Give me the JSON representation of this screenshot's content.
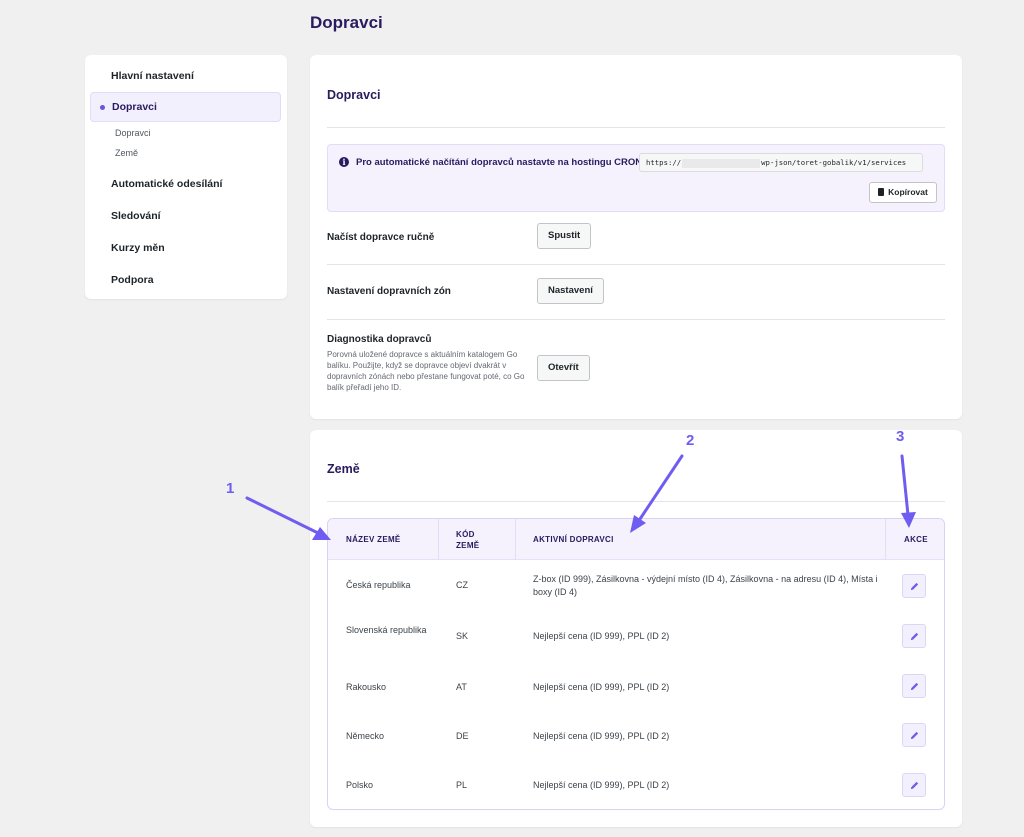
{
  "page": {
    "title": "Dopravci"
  },
  "sidebar": {
    "items": [
      {
        "label": "Hlavní nastavení"
      },
      {
        "label": "Dopravci",
        "subitems": [
          {
            "label": "Dopravci"
          },
          {
            "label": "Země"
          }
        ]
      },
      {
        "label": "Automatické odesílání"
      },
      {
        "label": "Sledování"
      },
      {
        "label": "Kurzy měn"
      },
      {
        "label": "Podpora"
      }
    ]
  },
  "carriers_card": {
    "title": "Dopravci",
    "notice": {
      "text": "Pro automatické načítání dopravců nastavte na hostingu CRON",
      "url_prefix": "https://",
      "url_suffix": "wp-json/toret-gobalik/v1/services",
      "copy_label": "Kopírovat"
    },
    "rows": [
      {
        "label": "Načíst dopravce ručně",
        "button": "Spustit"
      },
      {
        "label": "Nastavení dopravních zón",
        "button": "Nastavení"
      },
      {
        "label": "Diagnostika dopravců",
        "description": "Porovná uložené dopravce s aktuálním katalogem Go balíku. Použijte, když se dopravce objeví dvakrát v dopravních zónách nebo přestane fungovat poté, co Go balík přeřadí jeho ID.",
        "button": "Otevřít"
      }
    ]
  },
  "countries_card": {
    "title": "Země",
    "columns": [
      "NÁZEV ZEMĚ",
      "KÓD ZEMĚ",
      "AKTIVNÍ DOPRAVCI",
      "AKCE"
    ],
    "rows": [
      {
        "name": "Česká republika",
        "code": "CZ",
        "carriers": "Z-box (ID 999), Zásilkovna - výdejní místo (ID 4), Zásilkovna - na adresu (ID 4), Místa i boxy (ID 4)"
      },
      {
        "name": "Slovenská republika",
        "code": "SK",
        "carriers": "Nejlepší cena (ID 999), PPL (ID 2)"
      },
      {
        "name": "Rakousko",
        "code": "AT",
        "carriers": "Nejlepší cena (ID 999), PPL (ID 2)"
      },
      {
        "name": "Německo",
        "code": "DE",
        "carriers": "Nejlepší cena (ID 999), PPL (ID 2)"
      },
      {
        "name": "Polsko",
        "code": "PL",
        "carriers": "Nejlepší cena (ID 999), PPL (ID 2)"
      }
    ]
  },
  "annotations": [
    {
      "label": "1"
    },
    {
      "label": "2"
    },
    {
      "label": "3"
    }
  ],
  "colors": {
    "accent": "#6f5cf0",
    "title": "#2a1a5e",
    "panel_bg": "#f5f2fe"
  },
  "icons": {
    "notice": "info-icon",
    "copy": "copy-icon",
    "edit": "pencil-icon",
    "active_nav": "dot-icon"
  }
}
